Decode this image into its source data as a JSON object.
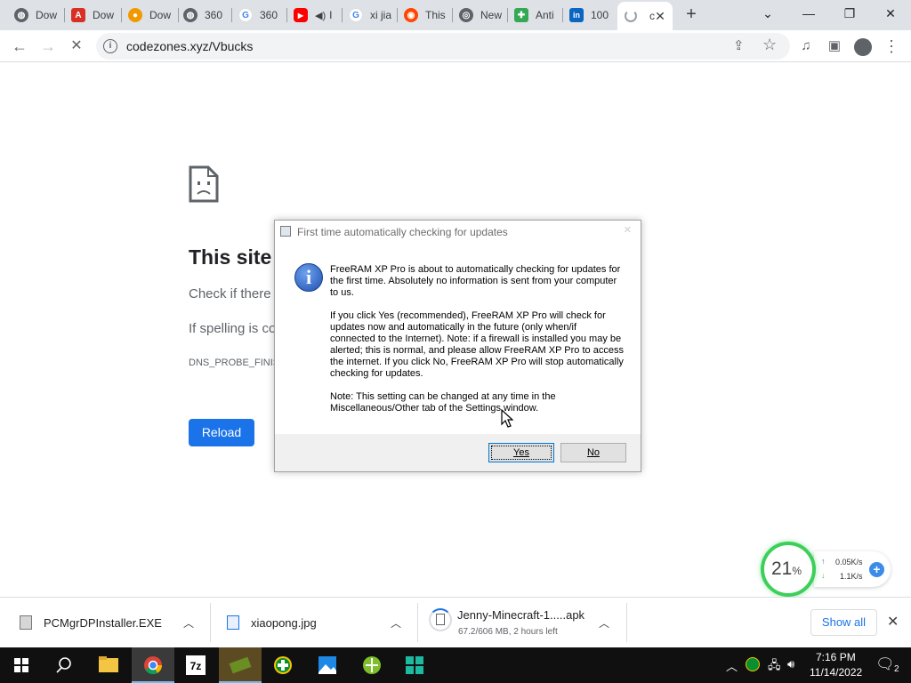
{
  "browser": {
    "tabs": [
      {
        "title": "Dow",
        "icon": "globe-icon",
        "color": "#5f6368"
      },
      {
        "title": "Dow",
        "icon": "pdf-icon",
        "color": "#d93025"
      },
      {
        "title": "Dow",
        "icon": "firefox-like-icon",
        "color": "#f29900"
      },
      {
        "title": "360",
        "icon": "globe-icon",
        "color": "#5f6368"
      },
      {
        "title": "360",
        "icon": "google-icon",
        "color": "#4285f4"
      },
      {
        "title": "I",
        "icon": "youtube-icon",
        "color": "#ff0000"
      },
      {
        "title": "xi jia",
        "icon": "google-icon",
        "color": "#4285f4"
      },
      {
        "title": "This",
        "icon": "reddit-icon",
        "color": "#ff4500"
      },
      {
        "title": "New",
        "icon": "chrome-icon",
        "color": "#5f6368"
      },
      {
        "title": "Anti",
        "icon": "puzzle-icon",
        "color": "#34a853"
      },
      {
        "title": "100",
        "icon": "linkedin-icon",
        "color": "#0a66c2"
      },
      {
        "title": "c",
        "icon": "loading-spinner-icon",
        "color": "#9aa0a6"
      }
    ],
    "url": "codezones.xyz/Vbucks"
  },
  "error_page": {
    "title": "This site c",
    "line1": "Check if there",
    "line2": "If spelling is co",
    "code": "DNS_PROBE_FINIS",
    "reload_label": "Reload"
  },
  "dialog": {
    "title": "First time automatically checking for updates",
    "paragraphs": [
      "FreeRAM XP Pro is about to automatically checking for updates for the first time. Absolutely no information is sent from your computer to us.",
      "If you click Yes (recommended), FreeRAM XP Pro will check for updates now and automatically in the future (only when/if connected to the Internet). Note: if a firewall is installed you may be alerted; this is normal, and please allow FreeRAM XP Pro to access the internet. If you click No, FreeRAM XP Pro will stop automatically checking for updates.",
      "Note: This setting can be changed at any time in the Miscellaneous/Other tab of the Settings window."
    ],
    "yes_label": "Yes",
    "no_label": "No"
  },
  "widget": {
    "percent": "21",
    "percent_sign": "%",
    "upload": "0.05K/s",
    "download": "1.1K/s",
    "ring_color": "#3ccf5a"
  },
  "downloads": {
    "items": [
      {
        "name": "PCMgrDPInstaller.EXE",
        "sub": ""
      },
      {
        "name": "xiaopong.jpg",
        "sub": ""
      },
      {
        "name": "Jenny-Minecraft-1.....apk",
        "sub": "67.2/606 MB, 2 hours left"
      }
    ],
    "show_all_label": "Show all"
  },
  "taskbar": {
    "time": "7:16 PM",
    "date": "11/14/2022",
    "notification_count": "2"
  },
  "colors": {
    "accent": "#1a73e8",
    "tab_strip": "#dee1e6"
  }
}
